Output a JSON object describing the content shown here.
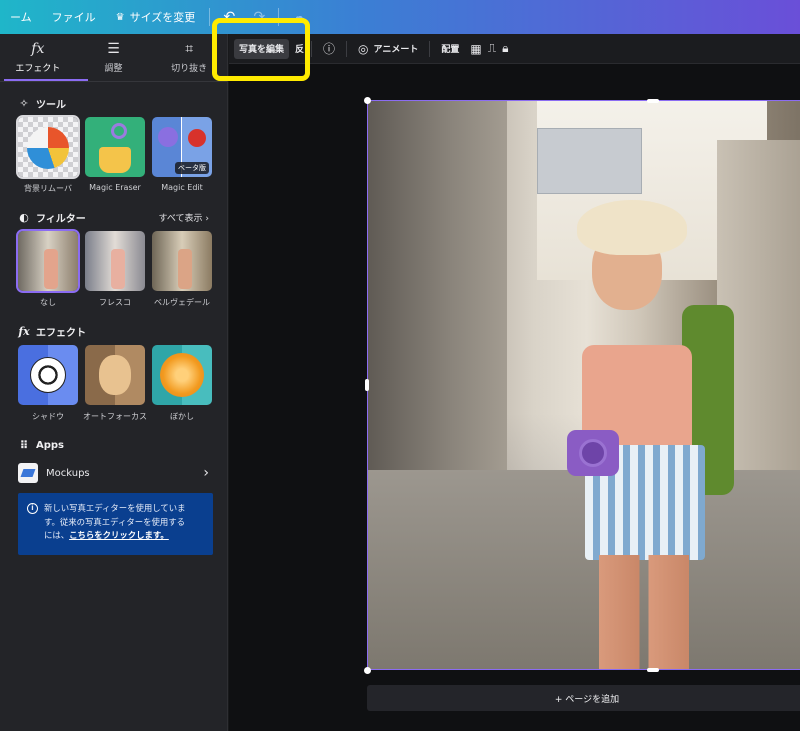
{
  "topbar": {
    "home_label": "ーム",
    "file_label": "ファイル",
    "resize_label": "サイズを変更",
    "crown_icon": "crown-icon",
    "undo_icon": "undo-icon",
    "redo_icon": "redo-icon",
    "cloud_icon": "cloud-icon"
  },
  "panel": {
    "tabs": [
      {
        "label": "エフェクト",
        "icon": "fx"
      },
      {
        "label": "調整",
        "icon": "sliders-icon"
      },
      {
        "label": "切り抜き",
        "icon": "crop-icon"
      }
    ],
    "tools": {
      "title": "ツール",
      "items": [
        {
          "label": "背景リムーバ"
        },
        {
          "label": "Magic Eraser"
        },
        {
          "label": "Magic Edit",
          "badge": "ベータ版"
        }
      ]
    },
    "filters": {
      "title": "フィルター",
      "see_all": "すべて表示",
      "items": [
        {
          "label": "なし"
        },
        {
          "label": "フレスコ"
        },
        {
          "label": "ベルヴェデール"
        }
      ]
    },
    "effects": {
      "title": "エフェクト",
      "items": [
        {
          "label": "シャドウ"
        },
        {
          "label": "オートフォーカス"
        },
        {
          "label": "ぼかし"
        }
      ]
    },
    "apps": {
      "title": "Apps",
      "mockups_label": "Mockups"
    },
    "notice": {
      "text1": "新しい写真エディターを使用していま",
      "text2": "す。従来の写真エディターを使用する",
      "text3": "には、",
      "link": "こちらをクリックします。"
    }
  },
  "canvas_toolbar": {
    "edit_photo": "写真を編集",
    "flip": "反",
    "animate": "アニメート",
    "position": "配置"
  },
  "canvas": {
    "add_page": "+ ページを追加"
  },
  "colors": {
    "accent": "#8b6cf2",
    "highlight": "#ffeb00",
    "notice_bg": "#0a3f8f"
  }
}
